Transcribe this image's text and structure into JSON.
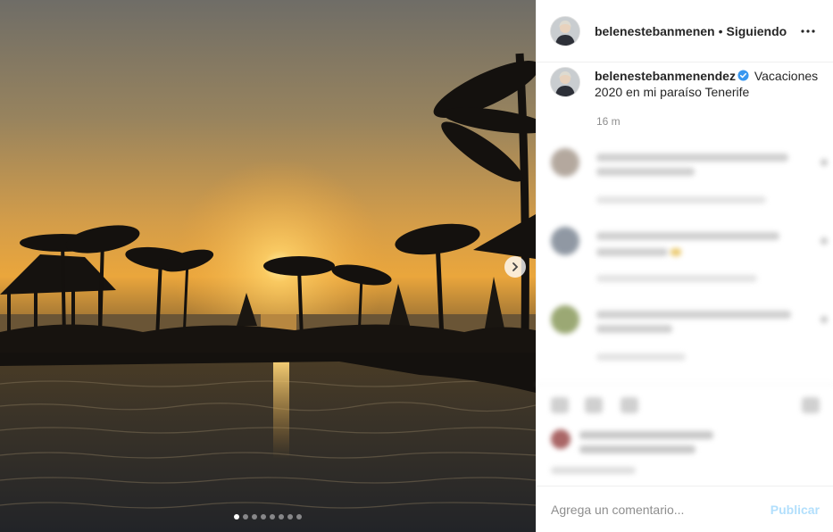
{
  "post": {
    "username_short": "belenestebanmenen",
    "separator": "•",
    "follow_status": "Siguiendo",
    "caption_username": "belenestebanmenendez",
    "caption_text": "Vacaciones 2020 en mi paraíso Tenerife",
    "time_ago": "16 m",
    "carousel": {
      "slide_count": 8,
      "active_index": 0
    }
  },
  "comment_box": {
    "placeholder": "Agrega un comentario...",
    "publish_label": "Publicar"
  },
  "colors": {
    "publish_disabled": "#b2dffc",
    "verified": "#3897f0",
    "muted_text": "#8e8e8e"
  },
  "icons": {
    "more": "more-horizontal-icon",
    "next": "chevron-right-icon",
    "verified": "verified-badge-icon"
  }
}
